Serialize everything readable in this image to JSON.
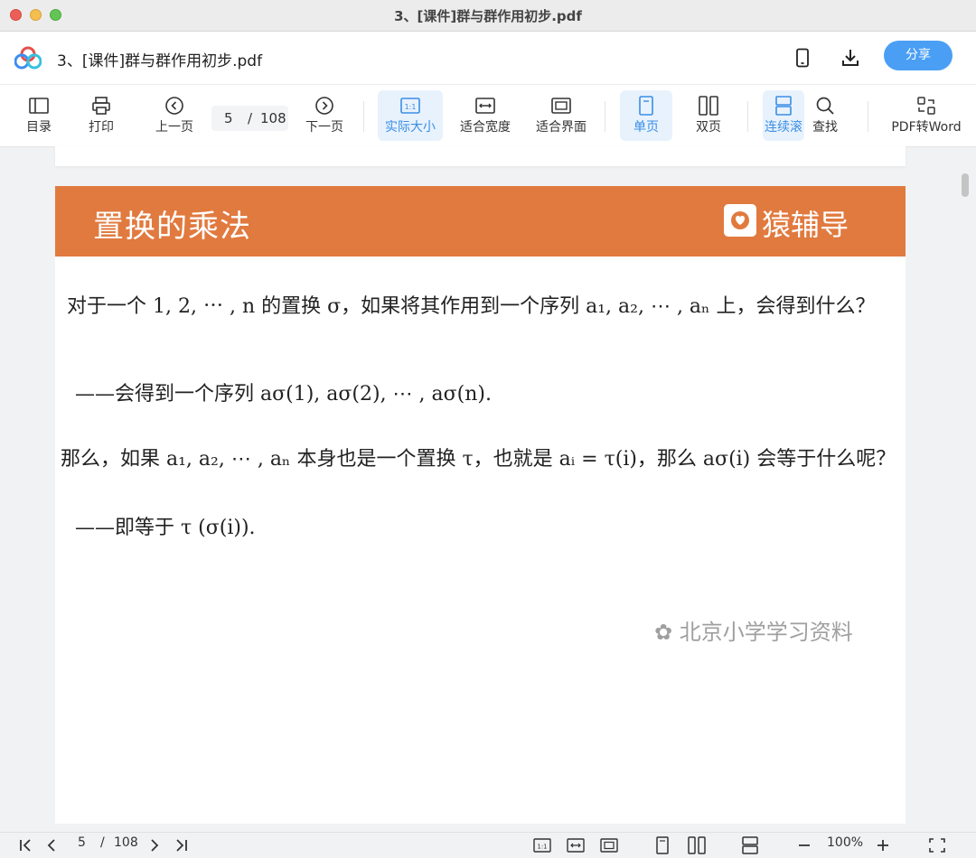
{
  "window": {
    "title": "3、[课件]群与群作用初步.pdf"
  },
  "header": {
    "filename": "3、[课件]群与群作用初步.pdf",
    "share_label": "分享"
  },
  "toolbar": {
    "toc": "目录",
    "print": "打印",
    "prev_page": "上一页",
    "current_page": "5",
    "page_sep": "/",
    "total_pages": "108",
    "next_page": "下一页",
    "actual_size": "实际大小",
    "fit_width": "适合宽度",
    "fit_screen": "适合界面",
    "single_page": "单页",
    "double_page": "双页",
    "continuous": "连续滚",
    "find": "查找",
    "pdf_to_word": "PDF转Word"
  },
  "page": {
    "banner_title": "置换的乘法",
    "brand": "猿辅导",
    "lines": [
      "对于一个 1, 2, ⋯ , n 的置换 σ，如果将其作用到一个序列 a₁, a₂, ⋯ , aₙ 上，会得到什么？",
      "——会得到一个序列 aσ(1), aσ(2), ⋯ , aσ(n).",
      "那么，如果 a₁, a₂, ⋯ , aₙ 本身也是一个置换 τ，也就是 aᵢ = τ(i)，那么 aσ(i) 会等于什么呢？",
      "——即等于 τ (σ(i))."
    ],
    "watermark": "北京小学学习资料"
  },
  "statusbar": {
    "current_page": "5",
    "page_sep": "/",
    "total_pages": "108",
    "zoom": "100%"
  }
}
